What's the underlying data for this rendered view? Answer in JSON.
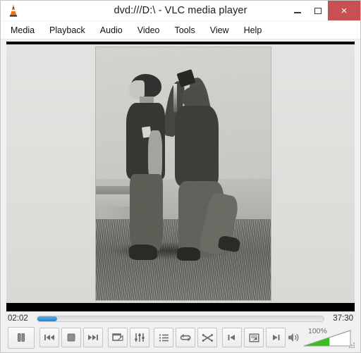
{
  "window": {
    "title": "dvd:///D:\\ - VLC media player",
    "app_icon": "vlc-cone-icon",
    "controls": {
      "minimize_label": "–",
      "maximize_label": "",
      "close_label": "×",
      "close_color": "#c75050"
    }
  },
  "menubar": {
    "items": [
      {
        "label": "Media",
        "name": "menu-media"
      },
      {
        "label": "Playback",
        "name": "menu-playback"
      },
      {
        "label": "Audio",
        "name": "menu-audio"
      },
      {
        "label": "Video",
        "name": "menu-video"
      },
      {
        "label": "Tools",
        "name": "menu-tools"
      },
      {
        "label": "View",
        "name": "menu-view"
      },
      {
        "label": "Help",
        "name": "menu-help"
      }
    ]
  },
  "video": {
    "description": "Black and white photograph of two soldiers standing on grass; the soldier on the right raises a canteen above the head of the soldier on the left, pouring liquid over him.",
    "letterbox_color": "#000000",
    "slide_color": "#dedeDB"
  },
  "playback": {
    "elapsed": "02:02",
    "total": "37:30",
    "progress_percent": 7,
    "progress_color": "#1e86d6",
    "state": "playing"
  },
  "toolbar": {
    "buttons": [
      {
        "name": "play-pause-button",
        "icon": "pause-icon",
        "tooltip": "Pause"
      },
      {
        "name": "previous-button",
        "icon": "previous-icon",
        "tooltip": "Previous"
      },
      {
        "name": "stop-button",
        "icon": "stop-icon",
        "tooltip": "Stop"
      },
      {
        "name": "next-button",
        "icon": "next-icon",
        "tooltip": "Next"
      },
      {
        "name": "fullscreen-button",
        "icon": "fullscreen-icon",
        "tooltip": "Toggle fullscreen"
      },
      {
        "name": "extended-settings-button",
        "icon": "equalizer-icon",
        "tooltip": "Show extended settings"
      },
      {
        "name": "playlist-button",
        "icon": "playlist-icon",
        "tooltip": "Show playlist"
      },
      {
        "name": "loop-button",
        "icon": "loop-icon",
        "tooltip": "Loop"
      },
      {
        "name": "random-button",
        "icon": "shuffle-icon",
        "tooltip": "Random"
      },
      {
        "name": "frame-back-button",
        "icon": "step-back-icon",
        "tooltip": "Previous chapter"
      },
      {
        "name": "menu-navigation-button",
        "icon": "dvd-menu-icon",
        "tooltip": "DVD menu"
      },
      {
        "name": "frame-forward-button",
        "icon": "step-forward-icon",
        "tooltip": "Next chapter"
      }
    ]
  },
  "volume": {
    "label": "100%",
    "level_percent": 55,
    "icon": "speaker-icon",
    "fill_color": "#35c11a"
  },
  "resize_grip": "resize-grip-icon"
}
